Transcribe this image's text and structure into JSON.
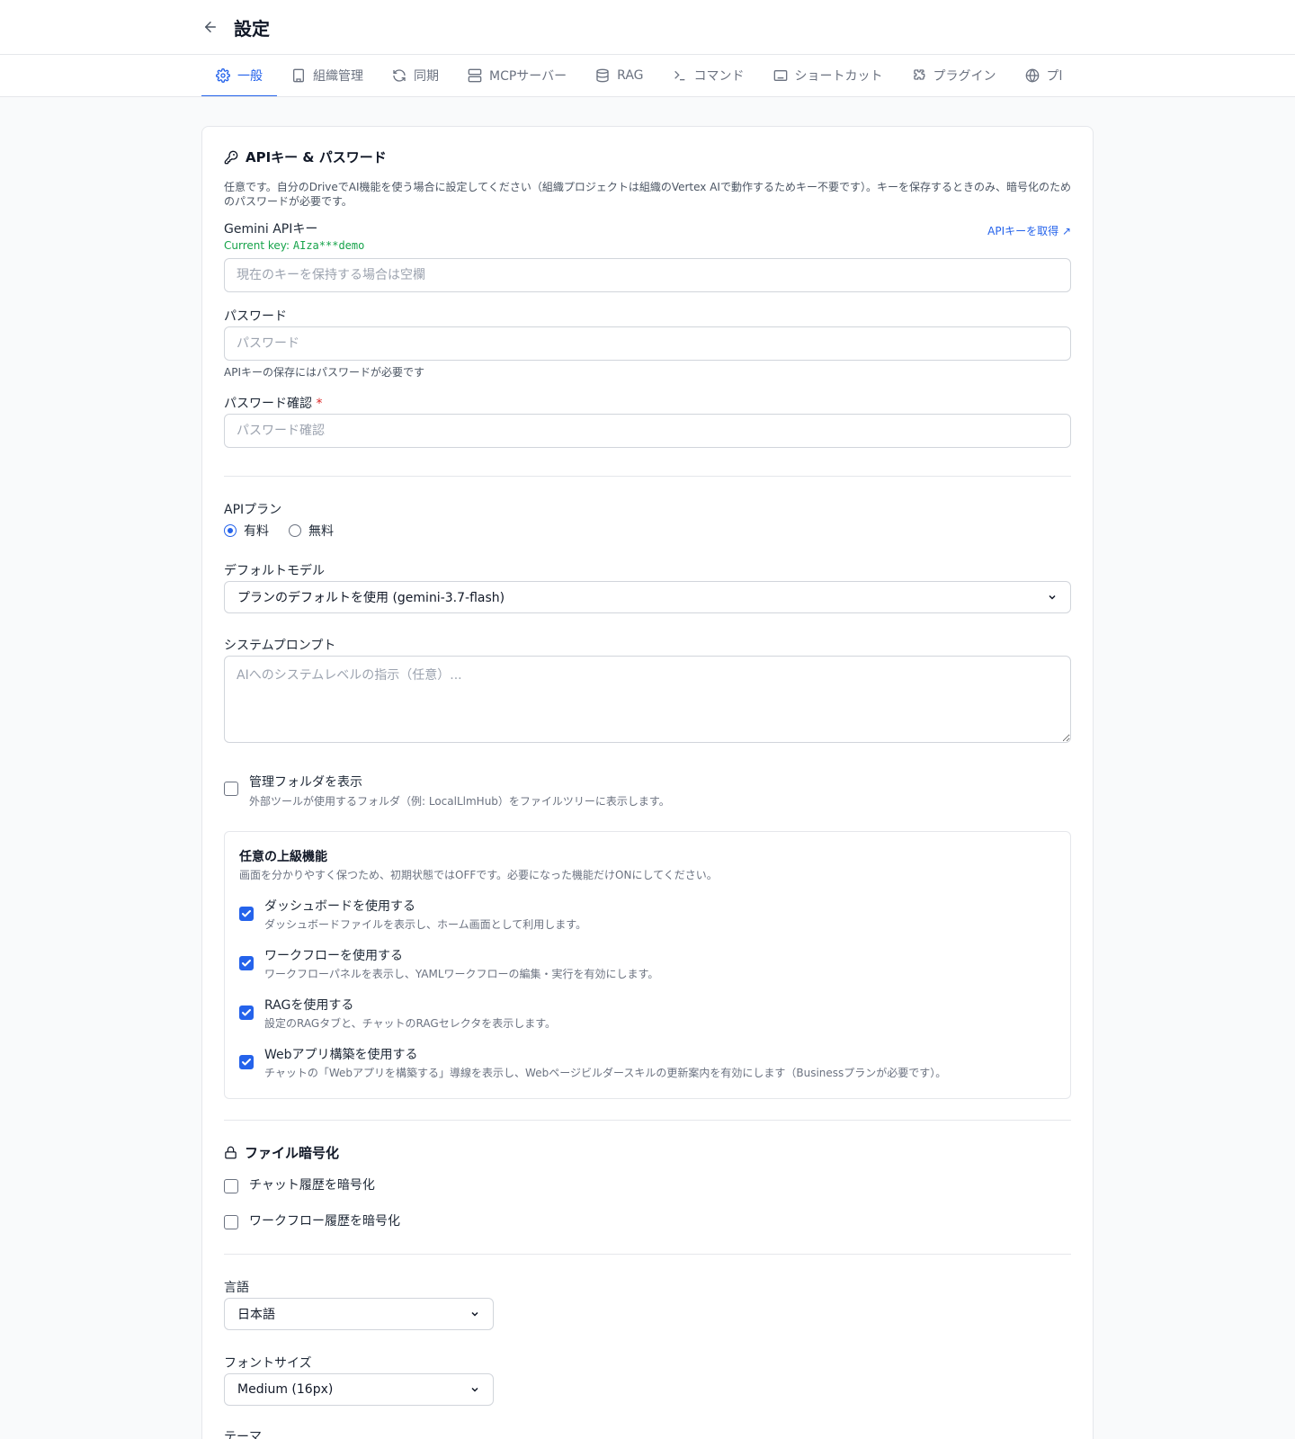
{
  "header": {
    "title": "設定"
  },
  "tabs": [
    {
      "label": "一般",
      "icon": "gear-icon",
      "active": true
    },
    {
      "label": "組織管理",
      "icon": "building-icon",
      "active": false
    },
    {
      "label": "同期",
      "icon": "refresh-icon",
      "active": false
    },
    {
      "label": "MCPサーバー",
      "icon": "server-icon",
      "active": false
    },
    {
      "label": "RAG",
      "icon": "database-icon",
      "active": false
    },
    {
      "label": "コマンド",
      "icon": "terminal-icon",
      "active": false
    },
    {
      "label": "ショートカット",
      "icon": "keyboard-icon",
      "active": false
    },
    {
      "label": "プラグイン",
      "icon": "puzzle-icon",
      "active": false
    },
    {
      "label": "プl",
      "icon": "globe-icon",
      "active": false
    }
  ],
  "api": {
    "title": "APIキー & パスワード",
    "description": "任意です。自分のDriveでAI機能を使う場合に設定してください（組織プロジェクトは組織のVertex AIで動作するためキー不要です）。キーを保存するときのみ、暗号化のためのパスワードが必要です。",
    "gemini_label": "Gemini APIキー",
    "get_key_link": "APIキーを取得 ↗",
    "current_key_prefix": "Current key: ",
    "current_key_value": "AIza***demo",
    "key_placeholder": "現在のキーを保持する場合は空欄",
    "password_label": "パスワード",
    "password_placeholder": "パスワード",
    "password_hint": "APIキーの保存にはパスワードが必要です",
    "confirm_label": "パスワード確認",
    "confirm_required": "*",
    "confirm_placeholder": "パスワード確認"
  },
  "plan": {
    "label": "APIプラン",
    "options": [
      {
        "label": "有料",
        "selected": true
      },
      {
        "label": "無料",
        "selected": false
      }
    ]
  },
  "model": {
    "label": "デフォルトモデル",
    "value": "プランのデフォルトを使用 (gemini-3.7-flash)"
  },
  "system_prompt": {
    "label": "システムプロンプト",
    "placeholder": "AIへのシステムレベルの指示（任意）..."
  },
  "admin_folder": {
    "label": "管理フォルダを表示",
    "description": "外部ツールが使用するフォルダ（例: LocalLlmHub）をファイルツリーに表示します。",
    "checked": false
  },
  "advanced": {
    "title": "任意の上級機能",
    "description": "画面を分かりやすく保つため、初期状態ではOFFです。必要になった機能だけONにしてください。",
    "items": [
      {
        "label": "ダッシュボードを使用する",
        "description": "ダッシュボードファイルを表示し、ホーム画面として利用します。",
        "checked": true
      },
      {
        "label": "ワークフローを使用する",
        "description": "ワークフローパネルを表示し、YAMLワークフローの編集・実行を有効にします。",
        "checked": true
      },
      {
        "label": "RAGを使用する",
        "description": "設定のRAGタブと、チャットのRAGセレクタを表示します。",
        "checked": true
      },
      {
        "label": "Webアプリ構築を使用する",
        "description": "チャットの「Webアプリを構築する」導線を表示し、Webページビルダースキルの更新案内を有効にします（Businessプランが必要です）。",
        "checked": true
      }
    ]
  },
  "encryption": {
    "title": "ファイル暗号化",
    "items": [
      {
        "label": "チャット履歴を暗号化",
        "checked": false
      },
      {
        "label": "ワークフロー履歴を暗号化",
        "checked": false
      }
    ]
  },
  "language": {
    "label": "言語",
    "value": "日本語"
  },
  "font_size": {
    "label": "フォントサイズ",
    "value": "Medium (16px)"
  },
  "theme": {
    "label": "テーマ"
  },
  "colors": {
    "accent": "#2563eb",
    "success": "#16a34a",
    "required": "#dc2626"
  }
}
